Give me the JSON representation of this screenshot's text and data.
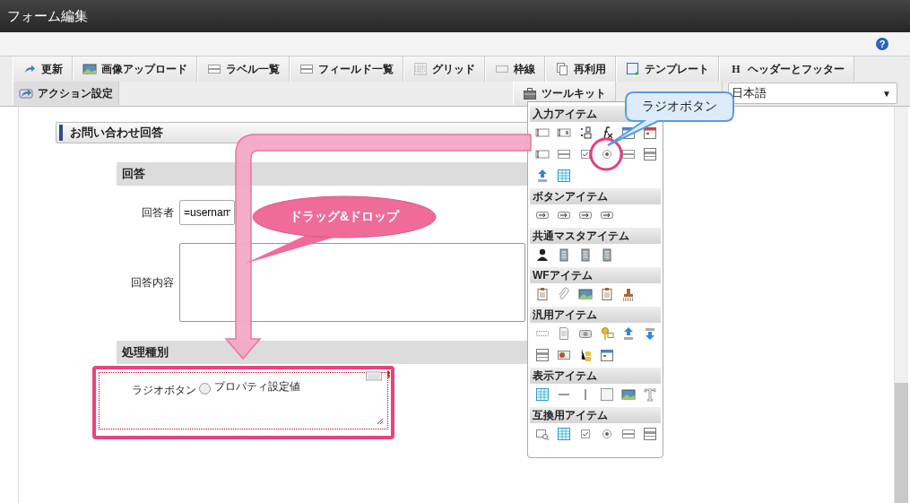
{
  "window": {
    "title": "フォーム編集"
  },
  "help": {
    "glyph": "?"
  },
  "toolbar": {
    "row1": [
      {
        "label": "更新"
      },
      {
        "label": "画像アップロード"
      },
      {
        "label": "ラベル一覧"
      },
      {
        "label": "フィールド一覧"
      },
      {
        "label": "グリッド"
      },
      {
        "label": "枠線"
      },
      {
        "label": "再利用"
      },
      {
        "label": "テンプレート"
      },
      {
        "label": "ヘッダーとフッター",
        "glyph": "H"
      }
    ],
    "row2": [
      {
        "label": "アクション設定"
      }
    ],
    "toolkit_button": {
      "label": "ツールキット"
    },
    "language_select": {
      "value": "日本語",
      "arrow": "▼"
    }
  },
  "form": {
    "title": "お問い合わせ回答",
    "sections": [
      {
        "heading": "回答",
        "fields": [
          {
            "kind": "text",
            "label": "回答者",
            "value": "=usernam"
          },
          {
            "kind": "textarea",
            "label": "回答内容"
          }
        ]
      },
      {
        "heading": "処理種別",
        "fields": [
          {
            "kind": "radio",
            "label": "ラジオボタン",
            "option": "プロパティ設定値",
            "checked": false,
            "highlighted": true
          }
        ]
      }
    ]
  },
  "palette": {
    "sections": [
      {
        "heading": "入力アイテム"
      },
      {
        "heading": "ボタンアイテム"
      },
      {
        "heading": "共通マスタアイテム"
      },
      {
        "heading": "WFアイテム"
      },
      {
        "heading": "汎用アイテム"
      },
      {
        "heading": "表示アイテム"
      },
      {
        "heading": "互換用アイテム"
      }
    ]
  },
  "callouts": [
    {
      "kind": "blue",
      "text": "ラジオボタン"
    },
    {
      "kind": "pink",
      "text": "ドラッグ&ドロップ"
    }
  ]
}
